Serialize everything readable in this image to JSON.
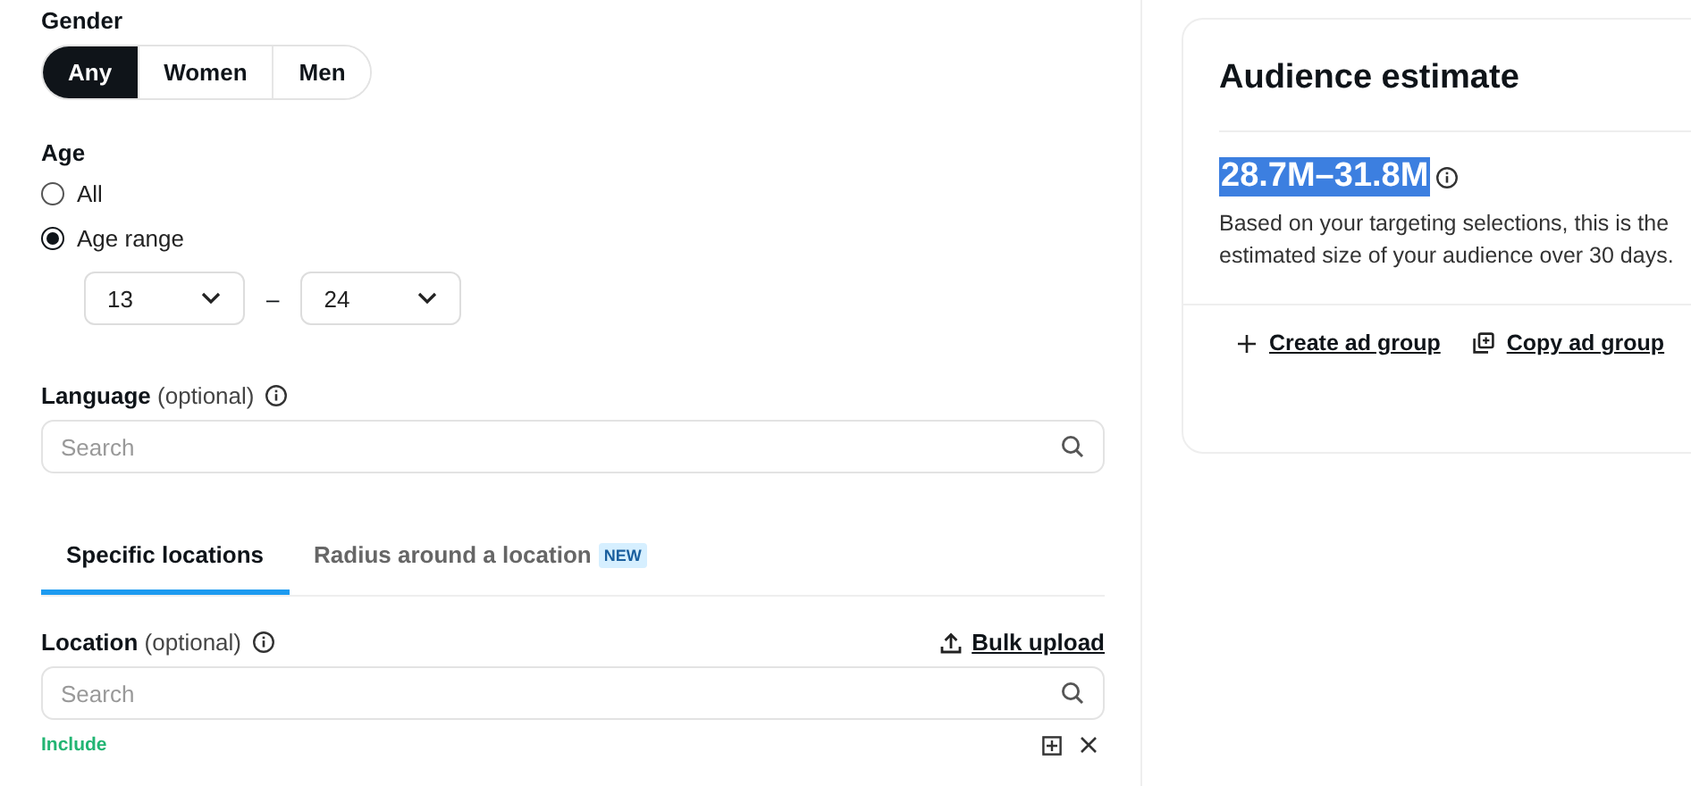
{
  "gender": {
    "label": "Gender",
    "options": [
      {
        "label": "Any",
        "selected": true
      },
      {
        "label": "Women",
        "selected": false
      },
      {
        "label": "Men",
        "selected": false
      }
    ]
  },
  "age": {
    "label": "Age",
    "options": [
      {
        "label": "All",
        "selected": false
      },
      {
        "label": "Age range",
        "selected": true
      }
    ],
    "from": "13",
    "separator": "–",
    "to": "24"
  },
  "language": {
    "label": "Language",
    "optional": "(optional)",
    "placeholder": "Search"
  },
  "location_tabs": [
    {
      "label": "Specific locations",
      "selected": true
    },
    {
      "label": "Radius around a location",
      "badge": "NEW",
      "selected": false
    }
  ],
  "location": {
    "label": "Location",
    "optional": "(optional)",
    "bulk_upload": "Bulk upload",
    "placeholder": "Search",
    "include": "Include"
  },
  "estimate": {
    "title": "Audience estimate",
    "range": "28.7M–31.8M",
    "highlighted": true,
    "description": "Based on your targeting selections, this is the estimated size of your audience over 30 days.",
    "actions": [
      {
        "kind": "create",
        "label": "Create ad group"
      },
      {
        "kind": "copy",
        "label": "Copy ad group"
      }
    ]
  }
}
